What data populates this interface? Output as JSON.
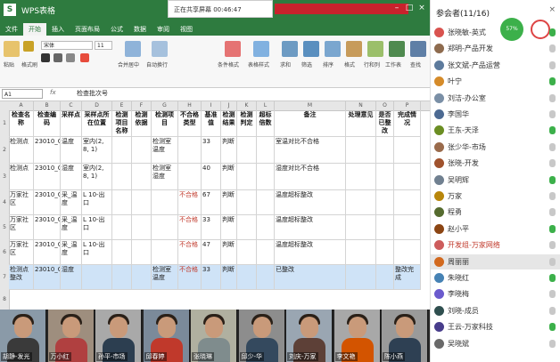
{
  "excel": {
    "app_label": "WPS表格",
    "title_text": "数据表.xlsx",
    "share_text": "正在共享屏幕  00:46:47",
    "tabs": [
      "文件",
      "开始",
      "插入",
      "页面布局",
      "公式",
      "数据",
      "审阅",
      "视图"
    ],
    "active_tab": 1,
    "font_name": "宋体",
    "font_size": "11",
    "ribbon_labels": [
      "粘贴",
      "格式刷",
      "合并居中",
      "自动换行",
      "条件格式",
      "表格样式",
      "求和",
      "筛选",
      "排序",
      "格式",
      "行和列",
      "工作表",
      "冻结窗格",
      "查找"
    ],
    "name_box": "A1",
    "formula_content": "检查批次号",
    "columns": [
      "A",
      "B",
      "C",
      "D",
      "E",
      "F",
      "G",
      "H",
      "I",
      "J",
      "K",
      "L",
      "M",
      "N",
      "O",
      "P"
    ],
    "row_numbers": [
      "1",
      "2",
      "3",
      "4",
      "5",
      "6",
      "7",
      "8"
    ],
    "headers": [
      "检查名称",
      "检查编码",
      "采样点",
      "采样点所在位置",
      "检测项目名称",
      "检测依据",
      "检测项目",
      "不合格类型",
      "基准值",
      "检测结果",
      "检测判定",
      "超标倍数",
      "备注",
      "处理意见",
      "是否已整改",
      "完成情况"
    ],
    "rows": [
      {
        "a": "检测点",
        "b": "23010_C",
        "c": "温度",
        "d": "室内(2, 8, 1)",
        "g": "检测室温度",
        "i": "33",
        "j": "判断",
        "m": "室温对比不合格"
      },
      {
        "a": "检测点",
        "b": "23010_C",
        "c": "湿度",
        "d": "室内(2, 8, 1)",
        "g": "检测室湿度",
        "i": "40",
        "j": "判断",
        "m": "湿度对比不合格"
      },
      {
        "a": "万家社区",
        "b": "23010_C",
        "c": "采_温度",
        "d": "L 10-出口",
        "h": "不合格",
        "i": "67",
        "j": "判断",
        "m": "温度超标整改"
      },
      {
        "a": "万家社区",
        "b": "23010_C",
        "c": "采_温度",
        "d": "L 10-出口",
        "h": "不合格",
        "i": "33",
        "j": "判断",
        "m": "温度超标整改"
      },
      {
        "a": "万家社区",
        "b": "23010_C",
        "c": "采_温度",
        "d": "L 10-出口",
        "h": "不合格",
        "i": "47",
        "j": "判断",
        "m": "温度超标整改"
      },
      {
        "a": "检测点整改",
        "b": "23010_C",
        "c": "湿度",
        "g": "检测室温度",
        "h": "不合格",
        "i": "33",
        "j": "判断",
        "m": "已整改",
        "p": "整改完成"
      }
    ]
  },
  "panel": {
    "title": "参会者(11/16)",
    "indicator": "57%",
    "participants": [
      {
        "name": "张晓敏-英式",
        "color": "#d9534f"
      },
      {
        "name": "郑明-产品开发",
        "color": "#8e6b4e"
      },
      {
        "name": "张文斌-产品运营",
        "color": "#5d7b9d"
      },
      {
        "name": "叶宁",
        "color": "#d58b2a"
      },
      {
        "name": "刘洁-办公室",
        "color": "#7a8fa6"
      },
      {
        "name": "李国华",
        "color": "#4c6a92"
      },
      {
        "name": "王东-天泽",
        "color": "#6b8e23"
      },
      {
        "name": "张少华-市场",
        "color": "#9a6b4c"
      },
      {
        "name": "张晓-开发",
        "color": "#a0522d"
      },
      {
        "name": "吴明辉",
        "color": "#708090"
      },
      {
        "name": "万家",
        "color": "#b8860b"
      },
      {
        "name": "程勇",
        "color": "#556b2f"
      },
      {
        "name": "赵小平",
        "color": "#8b4513"
      },
      {
        "name": "开发组-万家网络",
        "color": "#cd5c5c",
        "red": true
      },
      {
        "name": "周丽丽",
        "color": "#d2691e",
        "highlight": true
      },
      {
        "name": "朱晓红",
        "color": "#4682b4"
      },
      {
        "name": "李晓梅",
        "color": "#6a5acd"
      },
      {
        "name": "刘晓-成员",
        "color": "#2f4f4f"
      },
      {
        "name": "王云-万家科技",
        "color": "#483d8b"
      },
      {
        "name": "吴晓斌",
        "color": "#696969"
      }
    ]
  },
  "videos": [
    {
      "name": "胡静-发光",
      "shirt": "#3a3a3a",
      "bg": "#8a9aa8"
    },
    {
      "name": "万小红",
      "shirt": "#b04040",
      "bg": "#9e8e7e"
    },
    {
      "name": "孙平-市场",
      "shirt": "#2c3e50",
      "bg": "#a9a9a9"
    },
    {
      "name": "邱春婷",
      "shirt": "#c0392b",
      "bg": "#7b8a9a"
    },
    {
      "name": "张晓琳",
      "shirt": "#7f8c8d",
      "bg": "#b0b0a0"
    },
    {
      "name": "邱少-华",
      "shirt": "#34495e",
      "bg": "#8d8d8d"
    },
    {
      "name": "刘庆-万家",
      "shirt": "#5d4037",
      "bg": "#9aa6b2"
    },
    {
      "name": "李文艳",
      "shirt": "#d35400",
      "bg": "#a8a8a8"
    },
    {
      "name": "陈小燕",
      "shirt": "#2e4053",
      "bg": "#9a9a9a"
    }
  ]
}
